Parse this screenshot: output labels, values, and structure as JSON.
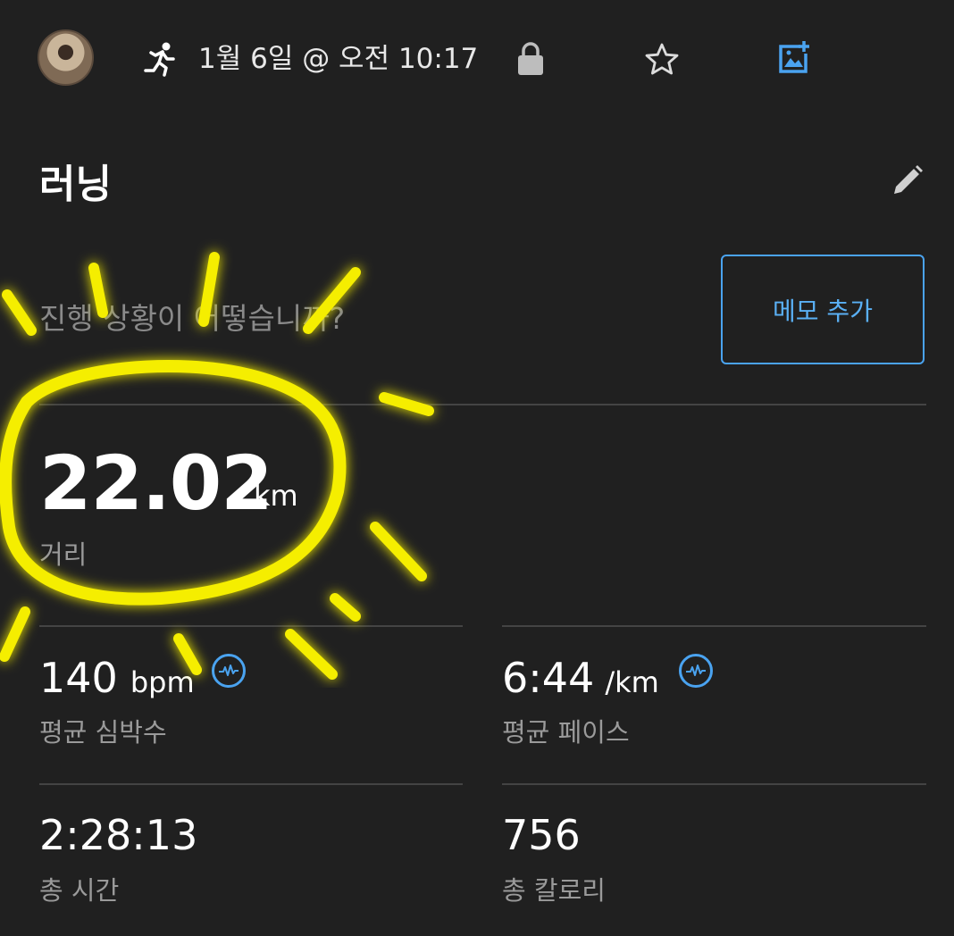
{
  "header": {
    "activity_icon": "running-icon",
    "datetime": "1월 6일 @ 오전 10:17",
    "icons": [
      "lock-icon",
      "star-icon",
      "add-photo-icon"
    ]
  },
  "activity": {
    "title": "러닝",
    "edit_icon": "pencil-icon"
  },
  "note": {
    "prompt": "진행 상황이 어떻습니까?",
    "add_memo_label": "메모 추가"
  },
  "distance": {
    "value": "22.02",
    "unit": "km",
    "label": "거리"
  },
  "stats": {
    "heart_rate": {
      "value": "140",
      "unit": "bpm",
      "label": "평균 심박수"
    },
    "pace": {
      "value": "6:44",
      "unit": "/km",
      "label": "평균 페이스"
    },
    "time": {
      "value": "2:28:13",
      "label": "총 시간"
    },
    "calories": {
      "value": "756",
      "label": "총 칼로리"
    }
  },
  "colors": {
    "background": "#202020",
    "accent": "#4aa3f0",
    "annotation": "#f5ee00"
  }
}
